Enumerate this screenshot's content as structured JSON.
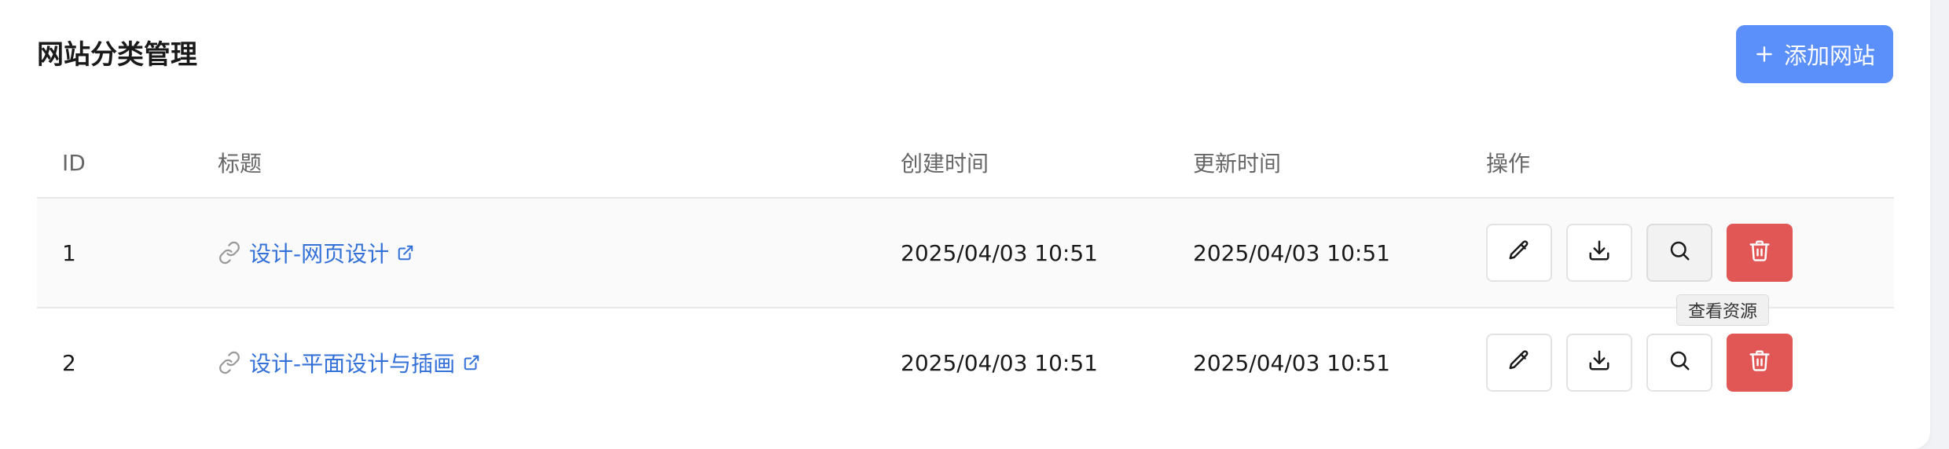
{
  "header": {
    "title": "网站分类管理",
    "add_label": "添加网站"
  },
  "table": {
    "columns": {
      "id": "ID",
      "title": "标题",
      "created": "创建时间",
      "updated": "更新时间",
      "actions": "操作"
    },
    "rows": [
      {
        "id": "1",
        "title": "设计-网页设计",
        "created": "2025/04/03 10:51",
        "updated": "2025/04/03 10:51"
      },
      {
        "id": "2",
        "title": "设计-平面设计与插画",
        "created": "2025/04/03 10:51",
        "updated": "2025/04/03 10:51"
      }
    ]
  },
  "tooltip": {
    "text": "查看资源"
  },
  "icons": {
    "add": "plus-icon",
    "link": "link-icon",
    "external": "external-link-icon",
    "edit": "pencil-icon",
    "download": "download-icon",
    "view": "search-icon",
    "delete": "trash-icon"
  },
  "colors": {
    "primary": "#5b8ff9",
    "link": "#3370d8",
    "danger": "#e15756"
  }
}
